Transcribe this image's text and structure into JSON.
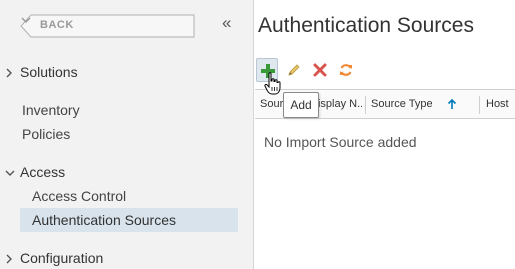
{
  "sidebar": {
    "back_label": "BACK",
    "collapse_glyph": "«",
    "groups": [
      {
        "label": "Solutions",
        "expanded": false
      },
      {
        "label": "Access",
        "expanded": true
      },
      {
        "label": "Configuration",
        "expanded": false
      }
    ],
    "items": [
      {
        "label": "Inventory"
      },
      {
        "label": "Policies"
      }
    ],
    "access_children": [
      {
        "label": "Access Control",
        "active": false
      },
      {
        "label": "Authentication Sources",
        "active": true
      }
    ]
  },
  "main": {
    "title": "Authentication Sources",
    "toolbar": {
      "add_icon": "plus-icon",
      "edit_icon": "pencil-icon",
      "delete_icon": "x-icon",
      "refresh_icon": "refresh-icon"
    },
    "tooltip": "Add",
    "columns": [
      "Sour",
      "Display N...",
      "Source Type",
      "Host"
    ],
    "sort": {
      "column": "Source Type",
      "direction": "ascending"
    },
    "empty_message": "No Import Source added"
  },
  "colors": {
    "sidebar_bg": "#f2f2f2",
    "active_item_bg": "#d8e3ec",
    "add_green": "#3a9a3a",
    "delete_red": "#d9534f",
    "refresh_orange": "#f08a36",
    "edit_yellow": "#c9a64a",
    "sort_blue": "#0079b8"
  }
}
